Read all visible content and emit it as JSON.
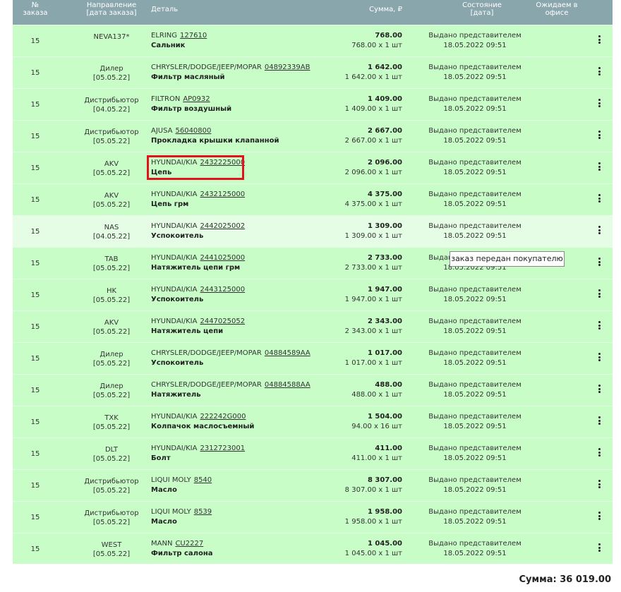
{
  "headers": {
    "num_line1": "№",
    "num_line2": "заказа",
    "dir_line1": "Направление",
    "dir_line2": "[дата заказа]",
    "detail": "Деталь",
    "sum": "Сумма, ₽",
    "status_line1": "Состояние",
    "status_line2": "[дата]",
    "await_line1": "Ожидаем в",
    "await_line2": "офисе"
  },
  "rows": [
    {
      "num": "15",
      "dir": "NEVA137*",
      "dir_date": "",
      "brand": "ELRING",
      "code": "127610",
      "desc": "Сальник",
      "sum": "768.00",
      "sum_detail": "768.00 x 1 шт",
      "status": "Выдано представителем",
      "status_date": "18.05.2022 09:51"
    },
    {
      "num": "15",
      "dir": "Дилер",
      "dir_date": "[05.05.22]",
      "brand": "CHRYSLER/DODGE/JEEP/MOPAR",
      "code": "04892339AB",
      "desc": "Фильтр масляный",
      "sum": "1 642.00",
      "sum_detail": "1 642.00 x 1 шт",
      "status": "Выдано представителем",
      "status_date": "18.05.2022 09:51"
    },
    {
      "num": "15",
      "dir": "Дистрибьютор",
      "dir_date": "[04.05.22]",
      "brand": "FILTRON",
      "code": "AP0932",
      "desc": "Фильтр воздушный",
      "sum": "1 409.00",
      "sum_detail": "1 409.00 x 1 шт",
      "status": "Выдано представителем",
      "status_date": "18.05.2022 09:51"
    },
    {
      "num": "15",
      "dir": "Дистрибьютор",
      "dir_date": "[05.05.22]",
      "brand": "AJUSA",
      "code": "56040800",
      "desc": "Прокладка крышки клапанной",
      "sum": "2 667.00",
      "sum_detail": "2 667.00 x 1 шт",
      "status": "Выдано представителем",
      "status_date": "18.05.2022 09:51"
    },
    {
      "num": "15",
      "dir": "AKV",
      "dir_date": "[05.05.22]",
      "brand": "HYUNDAI/KIA",
      "code": "2432225000",
      "desc": "Цепь",
      "sum": "2 096.00",
      "sum_detail": "2 096.00 x 1 шт",
      "status": "Выдано представителем",
      "status_date": "18.05.2022 09:51"
    },
    {
      "num": "15",
      "dir": "AKV",
      "dir_date": "[05.05.22]",
      "brand": "HYUNDAI/KIA",
      "code": "2432125000",
      "desc": "Цепь грм",
      "sum": "4 375.00",
      "sum_detail": "4 375.00 x 1 шт",
      "status": "Выдано представителем",
      "status_date": "18.05.2022 09:51"
    },
    {
      "num": "15",
      "dir": "NAS",
      "dir_date": "[04.05.22]",
      "brand": "HYUNDAI/KIA",
      "code": "2442025002",
      "desc": "Успокоитель",
      "sum": "1 309.00",
      "sum_detail": "1 309.00 x 1 шт",
      "status": "Выдано представителем",
      "status_date": "18.05.2022 09:51"
    },
    {
      "num": "15",
      "dir": "TAB",
      "dir_date": "[05.05.22]",
      "brand": "HYUNDAI/KIA",
      "code": "2441025000",
      "desc": "Натяжитель цепи грм",
      "sum": "2 733.00",
      "sum_detail": "2 733.00 x 1 шт",
      "status": "Выдано представителем",
      "status_date": "18.05.2022 09:51"
    },
    {
      "num": "15",
      "dir": "HK",
      "dir_date": "[05.05.22]",
      "brand": "HYUNDAI/KIA",
      "code": "2443125000",
      "desc": "Успокоитель",
      "sum": "1 947.00",
      "sum_detail": "1 947.00 x 1 шт",
      "status": "Выдано представителем",
      "status_date": "18.05.2022 09:51"
    },
    {
      "num": "15",
      "dir": "AKV",
      "dir_date": "[05.05.22]",
      "brand": "HYUNDAI/KIA",
      "code": "2447025052",
      "desc": "Натяжитель цепи",
      "sum": "2 343.00",
      "sum_detail": "2 343.00 x 1 шт",
      "status": "Выдано представителем",
      "status_date": "18.05.2022 09:51"
    },
    {
      "num": "15",
      "dir": "Дилер",
      "dir_date": "[05.05.22]",
      "brand": "CHRYSLER/DODGE/JEEP/MOPAR",
      "code": "04884589AA",
      "desc": "Успокоитель",
      "sum": "1 017.00",
      "sum_detail": "1 017.00 x 1 шт",
      "status": "Выдано представителем",
      "status_date": "18.05.2022 09:51"
    },
    {
      "num": "15",
      "dir": "Дилер",
      "dir_date": "[05.05.22]",
      "brand": "CHRYSLER/DODGE/JEEP/MOPAR",
      "code": "04884588AA",
      "desc": "Натяжитель",
      "sum": "488.00",
      "sum_detail": "488.00 x 1 шт",
      "status": "Выдано представителем",
      "status_date": "18.05.2022 09:51"
    },
    {
      "num": "15",
      "dir": "TXK",
      "dir_date": "[05.05.22]",
      "brand": "HYUNDAI/KIA",
      "code": "222242G000",
      "desc": "Колпачок маслосъемный",
      "sum": "1 504.00",
      "sum_detail": "94.00 x 16 шт",
      "status": "Выдано представителем",
      "status_date": "18.05.2022 09:51"
    },
    {
      "num": "15",
      "dir": "DLT",
      "dir_date": "[05.05.22]",
      "brand": "HYUNDAI/KIA",
      "code": "2312723001",
      "desc": "Болт",
      "sum": "411.00",
      "sum_detail": "411.00 x 1 шт",
      "status": "Выдано представителем",
      "status_date": "18.05.2022 09:51"
    },
    {
      "num": "15",
      "dir": "Дистрибьютор",
      "dir_date": "[05.05.22]",
      "brand": "LIQUI MOLY",
      "code": "8540",
      "desc": "Масло",
      "sum": "8 307.00",
      "sum_detail": "8 307.00 x 1 шт",
      "status": "Выдано представителем",
      "status_date": "18.05.2022 09:51"
    },
    {
      "num": "15",
      "dir": "Дистрибьютор",
      "dir_date": "[05.05.22]",
      "brand": "LIQUI MOLY",
      "code": "8539",
      "desc": "Масло",
      "sum": "1 958.00",
      "sum_detail": "1 958.00 x 1 шт",
      "status": "Выдано представителем",
      "status_date": "18.05.2022 09:51"
    },
    {
      "num": "15",
      "dir": "WEST",
      "dir_date": "[05.05.22]",
      "brand": "MANN",
      "code": "CU2227",
      "desc": "Фильтр салона",
      "sum": "1 045.00",
      "sum_detail": "1 045.00 x 1 шт",
      "status": "Выдано представителем",
      "status_date": "18.05.2022 09:51"
    }
  ],
  "tooltip": "заказ передан покупателю",
  "total": "Сумма: 36 019.00",
  "colors": {
    "header_bg": "#8aa6ad",
    "row_bg": "#c8fdc8",
    "row_hover_bg": "#e4fde4",
    "highlight": "#e0141a"
  }
}
